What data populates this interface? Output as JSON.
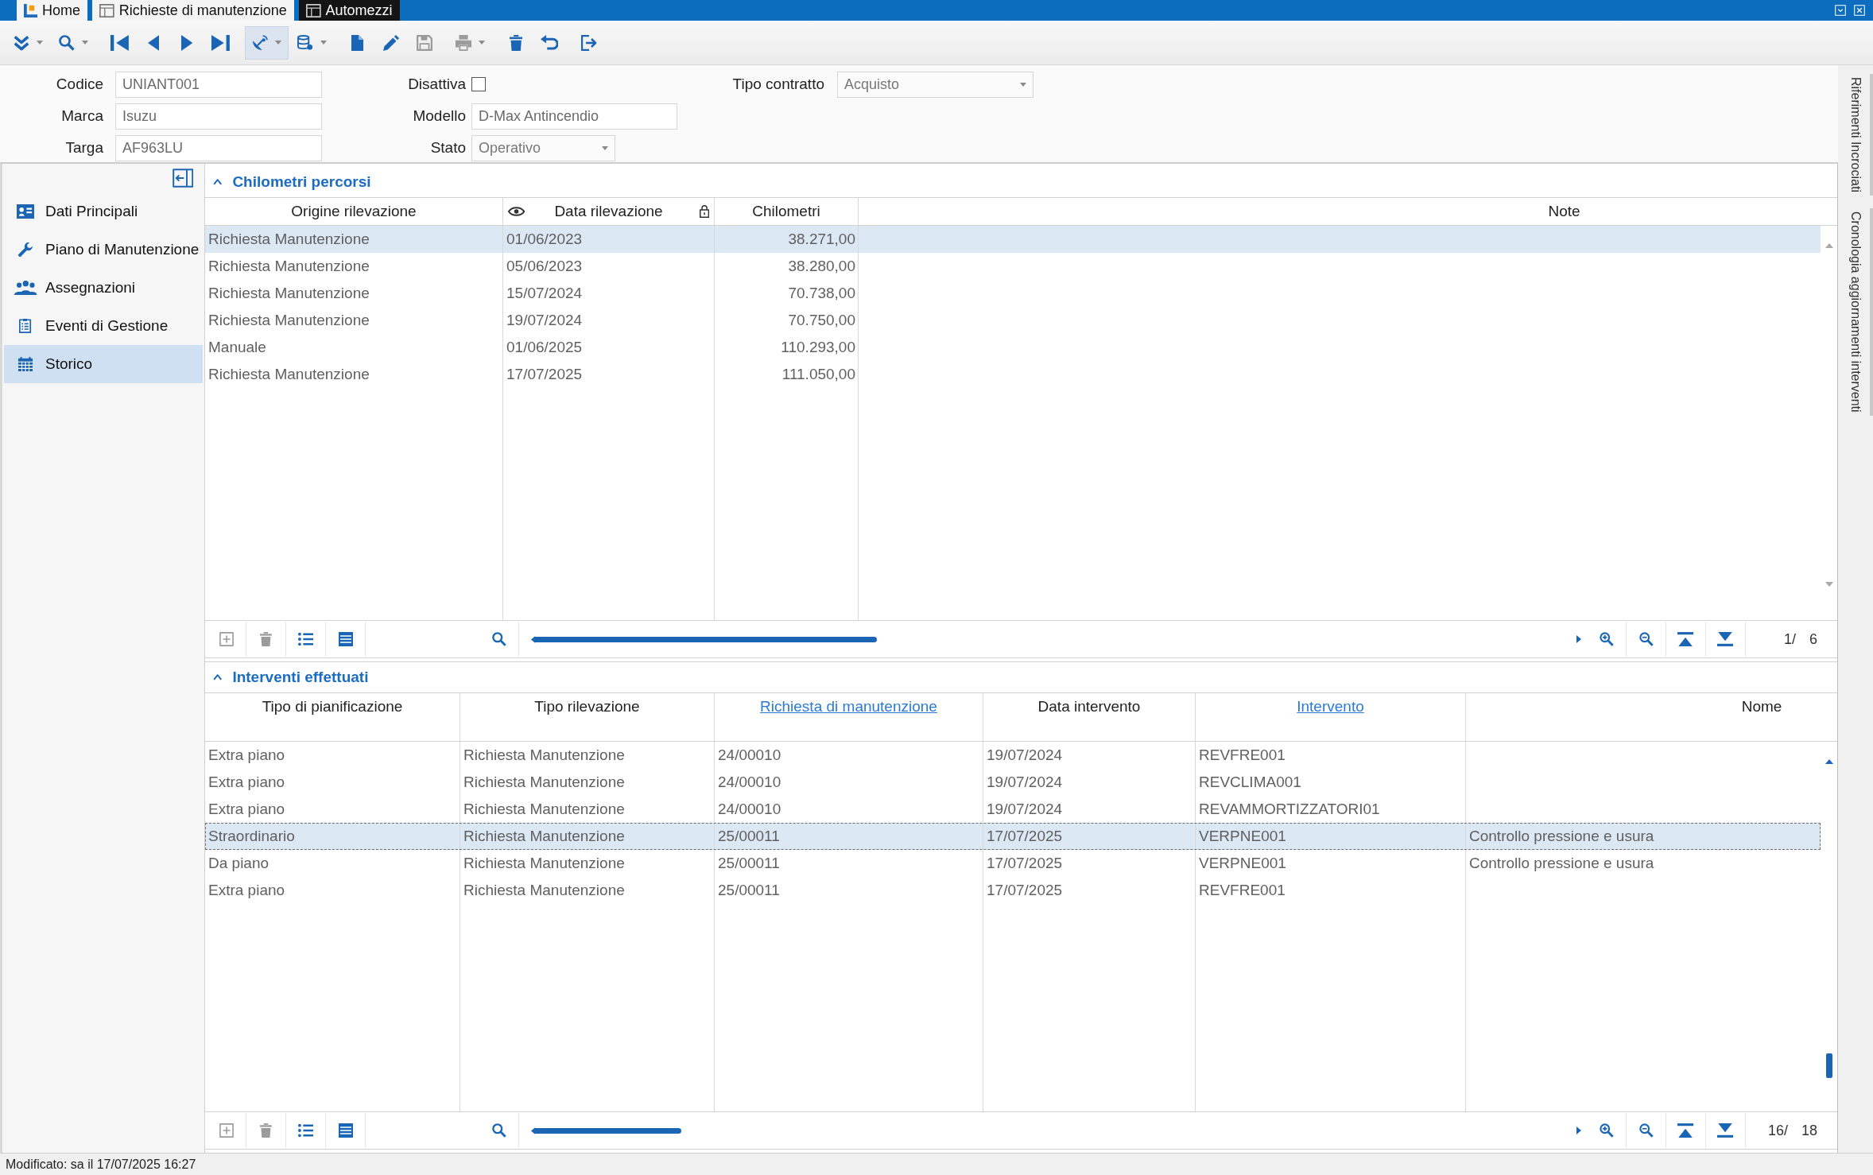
{
  "tabs": [
    {
      "label": "Home",
      "kind": "home",
      "selected": false
    },
    {
      "label": "Richieste di manutenzione",
      "kind": "form",
      "selected": false
    },
    {
      "label": "Automezzi",
      "kind": "form",
      "selected": true
    }
  ],
  "toolbar": {
    "groups": [
      [
        {
          "kind": "expand",
          "dropdown": true,
          "disabled": false,
          "active": false
        },
        {
          "kind": "search",
          "dropdown": true,
          "disabled": false,
          "active": false
        }
      ],
      [
        {
          "kind": "first",
          "dropdown": false,
          "disabled": false,
          "active": false
        },
        {
          "kind": "previous",
          "dropdown": false,
          "disabled": false,
          "active": false
        },
        {
          "kind": "next",
          "dropdown": false,
          "disabled": false,
          "active": false
        },
        {
          "kind": "last",
          "dropdown": false,
          "disabled": false,
          "active": false
        }
      ],
      [
        {
          "kind": "satellite",
          "dropdown": true,
          "disabled": false,
          "active": true
        },
        {
          "kind": "database",
          "dropdown": true,
          "disabled": false,
          "active": false
        }
      ],
      [
        {
          "kind": "new",
          "dropdown": false,
          "disabled": false,
          "active": false
        },
        {
          "kind": "edit",
          "dropdown": false,
          "disabled": false,
          "active": false
        },
        {
          "kind": "save",
          "dropdown": false,
          "disabled": true,
          "active": false
        }
      ],
      [
        {
          "kind": "print",
          "dropdown": true,
          "disabled": true,
          "active": false
        }
      ],
      [
        {
          "kind": "delete",
          "dropdown": false,
          "disabled": false,
          "active": false
        },
        {
          "kind": "undo",
          "dropdown": false,
          "disabled": false,
          "active": false
        }
      ],
      [
        {
          "kind": "exit",
          "dropdown": false,
          "disabled": false,
          "active": false
        }
      ]
    ]
  },
  "form": {
    "rows": [
      {
        "fields": [
          {
            "label": "Codice",
            "kind": "text",
            "value": "UNIANT001"
          },
          {
            "label": "Disattiva",
            "kind": "checkbox",
            "checked": false
          },
          {
            "label": "Tipo contratto",
            "kind": "select",
            "value": "Acquisto"
          }
        ]
      },
      {
        "fields": [
          {
            "label": "Marca",
            "kind": "text",
            "value": "Isuzu"
          },
          {
            "label": "Modello",
            "kind": "text",
            "value": "D-Max Antincendio"
          }
        ]
      },
      {
        "fields": [
          {
            "label": "Targa",
            "kind": "text",
            "value": "AF963LU"
          },
          {
            "label": "Stato",
            "kind": "select",
            "value": "Operativo"
          }
        ]
      }
    ]
  },
  "sidebar": {
    "items": [
      {
        "label": "Dati Principali",
        "kind": "card",
        "selected": false
      },
      {
        "label": "Piano di Manutenzione",
        "kind": "wrench",
        "selected": false
      },
      {
        "label": "Assegnazioni",
        "kind": "people",
        "selected": false
      },
      {
        "label": "Eventi di Gestione",
        "kind": "checklist",
        "selected": false
      },
      {
        "label": "Storico",
        "kind": "calendar",
        "selected": true
      }
    ]
  },
  "sections": [
    {
      "title": "Chilometri percorsi",
      "expanded": true,
      "table": {
        "focused": false,
        "columns": [
          {
            "label": "Origine rilevazione",
            "kind": "text",
            "tracked": false,
            "locked": false
          },
          {
            "label": "Data rilevazione",
            "kind": "text",
            "tracked": true,
            "locked": true
          },
          {
            "label": "Chilometri",
            "kind": "number",
            "tracked": false,
            "locked": false
          },
          {
            "label": "Note",
            "kind": "text",
            "tracked": false,
            "locked": false
          }
        ],
        "rows": [
          {
            "cells": [
              "Richiesta Manutenzione",
              "01/06/2023",
              "38.271,00"
            ],
            "selected": true
          },
          {
            "cells": [
              "Richiesta Manutenzione",
              "05/06/2023",
              "38.280,00"
            ],
            "selected": false
          },
          {
            "cells": [
              "Richiesta Manutenzione",
              "15/07/2024",
              "70.738,00"
            ],
            "selected": false
          },
          {
            "cells": [
              "Richiesta Manutenzione",
              "19/07/2024",
              "70.750,00"
            ],
            "selected": false
          },
          {
            "cells": [
              "Manuale",
              "01/06/2025",
              "110.293,00"
            ],
            "selected": false
          },
          {
            "cells": [
              "Richiesta Manutenzione",
              "17/07/2025",
              "111.050,00"
            ],
            "selected": false
          }
        ]
      },
      "footer": {
        "tools": [
          [
            {
              "kind": "add",
              "disabled": true
            },
            {
              "kind": "delete",
              "disabled": true
            },
            {
              "kind": "details",
              "disabled": false
            },
            {
              "kind": "grid",
              "disabled": false
            }
          ],
          [
            {
              "kind": "search",
              "disabled": false
            }
          ]
        ],
        "nav": [
          {
            "kind": "zoomin",
            "disabled": false
          },
          {
            "kind": "zoomout",
            "disabled": false
          },
          {
            "kind": "top",
            "disabled": false
          },
          {
            "kind": "bottom",
            "disabled": false
          }
        ],
        "pager": "1/ 6"
      }
    },
    {
      "title": "Interventi effettuati",
      "expanded": true,
      "table": {
        "focused": true,
        "columns": [
          {
            "label": "Tipo di pianificazione",
            "kind": "text",
            "link": false
          },
          {
            "label": "Tipo rilevazione",
            "kind": "text",
            "link": false
          },
          {
            "label": "Richiesta di manutenzione",
            "kind": "text",
            "link": true
          },
          {
            "label": "Data intervento",
            "kind": "text",
            "link": false
          },
          {
            "label": "Intervento",
            "kind": "text",
            "link": true
          },
          {
            "label": "Nome",
            "kind": "text",
            "link": false
          }
        ],
        "rows": [
          {
            "cells": [
              "Extra piano",
              "Richiesta Manutenzione",
              "24/00010",
              "19/07/2024",
              "REVFRE001"
            ],
            "selected": false
          },
          {
            "cells": [
              "Extra piano",
              "Richiesta Manutenzione",
              "24/00010",
              "19/07/2024",
              "REVCLIMA001"
            ],
            "selected": false
          },
          {
            "cells": [
              "Extra piano",
              "Richiesta Manutenzione",
              "24/00010",
              "19/07/2024",
              "REVAMMORTIZZATORI01"
            ],
            "selected": false
          },
          {
            "cells": [
              "Straordinario",
              "Richiesta Manutenzione",
              "25/00011",
              "17/07/2025",
              "VERPNE001",
              "Controllo pressione e usura"
            ],
            "selected": true
          },
          {
            "cells": [
              "Da piano",
              "Richiesta Manutenzione",
              "25/00011",
              "17/07/2025",
              "VERPNE001",
              "Controllo pressione e usura"
            ],
            "selected": false
          },
          {
            "cells": [
              "Extra piano",
              "Richiesta Manutenzione",
              "25/00011",
              "17/07/2025",
              "REVFRE001"
            ],
            "selected": false
          }
        ]
      },
      "footer": {
        "tools": [
          [
            {
              "kind": "add",
              "disabled": true
            },
            {
              "kind": "delete",
              "disabled": true
            },
            {
              "kind": "details",
              "disabled": false
            },
            {
              "kind": "grid",
              "disabled": false
            }
          ],
          [
            {
              "kind": "search",
              "disabled": false
            }
          ]
        ],
        "nav": [
          {
            "kind": "zoomin",
            "disabled": false
          },
          {
            "kind": "zoomout",
            "disabled": false
          },
          {
            "kind": "top",
            "disabled": false
          },
          {
            "kind": "bottom",
            "disabled": false
          }
        ],
        "pager": "16/ 18"
      }
    }
  ],
  "side_tabs": [
    {
      "label": "Riferimenti Incrociati"
    },
    {
      "label": "Cronologia aggiornamenti interventi"
    }
  ],
  "status_bar": "Modificato: sa il 17/07/2025 16:27"
}
